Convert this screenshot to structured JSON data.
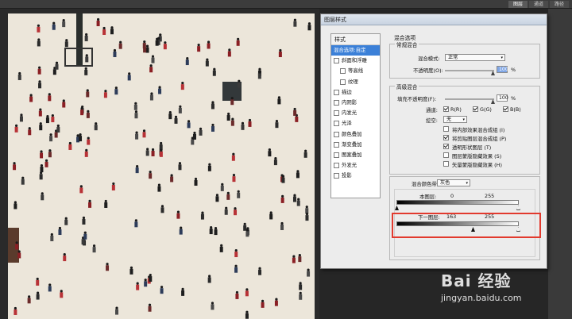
{
  "top_tabs": [
    "图层",
    "通道",
    "路径"
  ],
  "dialog": {
    "title": "图层样式",
    "styles_header": "样式",
    "style_items": [
      {
        "label": "混合选项:自定",
        "checkbox": false,
        "selected": true,
        "indent": false
      },
      {
        "label": "斜面和浮雕",
        "checkbox": true,
        "checked": false,
        "indent": false
      },
      {
        "label": "等高线",
        "checkbox": true,
        "checked": false,
        "indent": true
      },
      {
        "label": "纹理",
        "checkbox": true,
        "checked": false,
        "indent": true
      },
      {
        "label": "描边",
        "checkbox": true,
        "checked": false,
        "indent": false
      },
      {
        "label": "内阴影",
        "checkbox": true,
        "checked": false,
        "indent": false
      },
      {
        "label": "内发光",
        "checkbox": true,
        "checked": false,
        "indent": false
      },
      {
        "label": "光泽",
        "checkbox": true,
        "checked": false,
        "indent": false
      },
      {
        "label": "颜色叠加",
        "checkbox": true,
        "checked": false,
        "indent": false
      },
      {
        "label": "渐变叠加",
        "checkbox": true,
        "checked": false,
        "indent": false
      },
      {
        "label": "图案叠加",
        "checkbox": true,
        "checked": false,
        "indent": false
      },
      {
        "label": "外发光",
        "checkbox": true,
        "checked": false,
        "indent": false
      },
      {
        "label": "投影",
        "checkbox": true,
        "checked": false,
        "indent": false
      }
    ],
    "blend_options_title": "混合选项",
    "general_blending": {
      "title": "常规混合",
      "mode_label": "混合模式:",
      "mode_value": "正常",
      "opacity_label": "不透明度(O):",
      "opacity_value": "100",
      "percent": "%"
    },
    "advanced_blending": {
      "title": "高级混合",
      "fill_label": "填充不透明度(F):",
      "fill_value": "100",
      "percent": "%",
      "channels_label": "通道:",
      "channel_r": "R(R)",
      "channel_g": "G(G)",
      "channel_b": "B(B)",
      "knockout_label": "挖空:",
      "knockout_value": "无",
      "options": [
        {
          "label": "将内部效果混合成组 (I)",
          "checked": false
        },
        {
          "label": "将剪贴图层混合成组 (P)",
          "checked": true
        },
        {
          "label": "透明形状图层 (T)",
          "checked": true
        },
        {
          "label": "图层蒙版隐藏效果 (S)",
          "checked": false
        },
        {
          "label": "矢量蒙版隐藏效果 (H)",
          "checked": false
        }
      ]
    },
    "blend_if": {
      "label": "混合颜色带:",
      "value": "灰色",
      "this_layer_label": "本图层:",
      "this_layer_min": "0",
      "this_layer_max": "255",
      "underlying_label": "下一图层:",
      "underlying_min": "163",
      "underlying_max": "255"
    }
  },
  "watermark": {
    "main": "Bai 经验",
    "sub": "jingyan.baidu.com"
  }
}
